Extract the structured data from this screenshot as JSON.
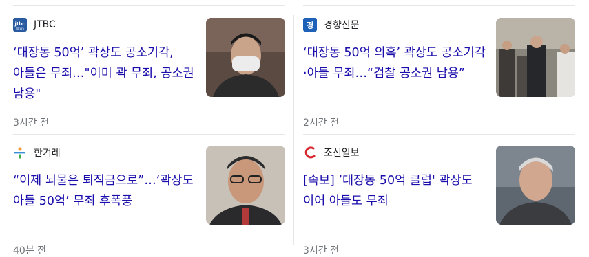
{
  "articles": [
    {
      "source": "JTBC",
      "logo_text": "jtbc",
      "headline": "‘대장동 50억’ 곽상도 공소기각, 아들은 무죄…\"이미 곽 무죄, 공소권 남용\"",
      "time": "3시간 전",
      "thumb_desc": "man-with-mask"
    },
    {
      "source": "경향신문",
      "logo_text": "경",
      "headline": "‘대장동 50억 의혹’ 곽상도 공소기각·아들 무죄…“검찰 공소권 남용”",
      "time": "2시간 전",
      "thumb_desc": "group-court"
    },
    {
      "source": "한겨레",
      "logo_text": "",
      "headline": "“이제 뇌물은 퇴직금으로”…‘곽상도 아들 50억’ 무죄 후폭풍",
      "time": "40분 전",
      "thumb_desc": "man-with-glasses"
    },
    {
      "source": "조선일보",
      "logo_text": "",
      "headline": "[속보] ’대장동 50억 클럽' 곽상도 이어 아들도 무죄",
      "time": "3시간 전",
      "thumb_desc": "older-man"
    }
  ],
  "colors": {
    "headline": "#1a0dab",
    "source": "#202124",
    "time": "#70757a",
    "divider": "#e6e6e6"
  }
}
